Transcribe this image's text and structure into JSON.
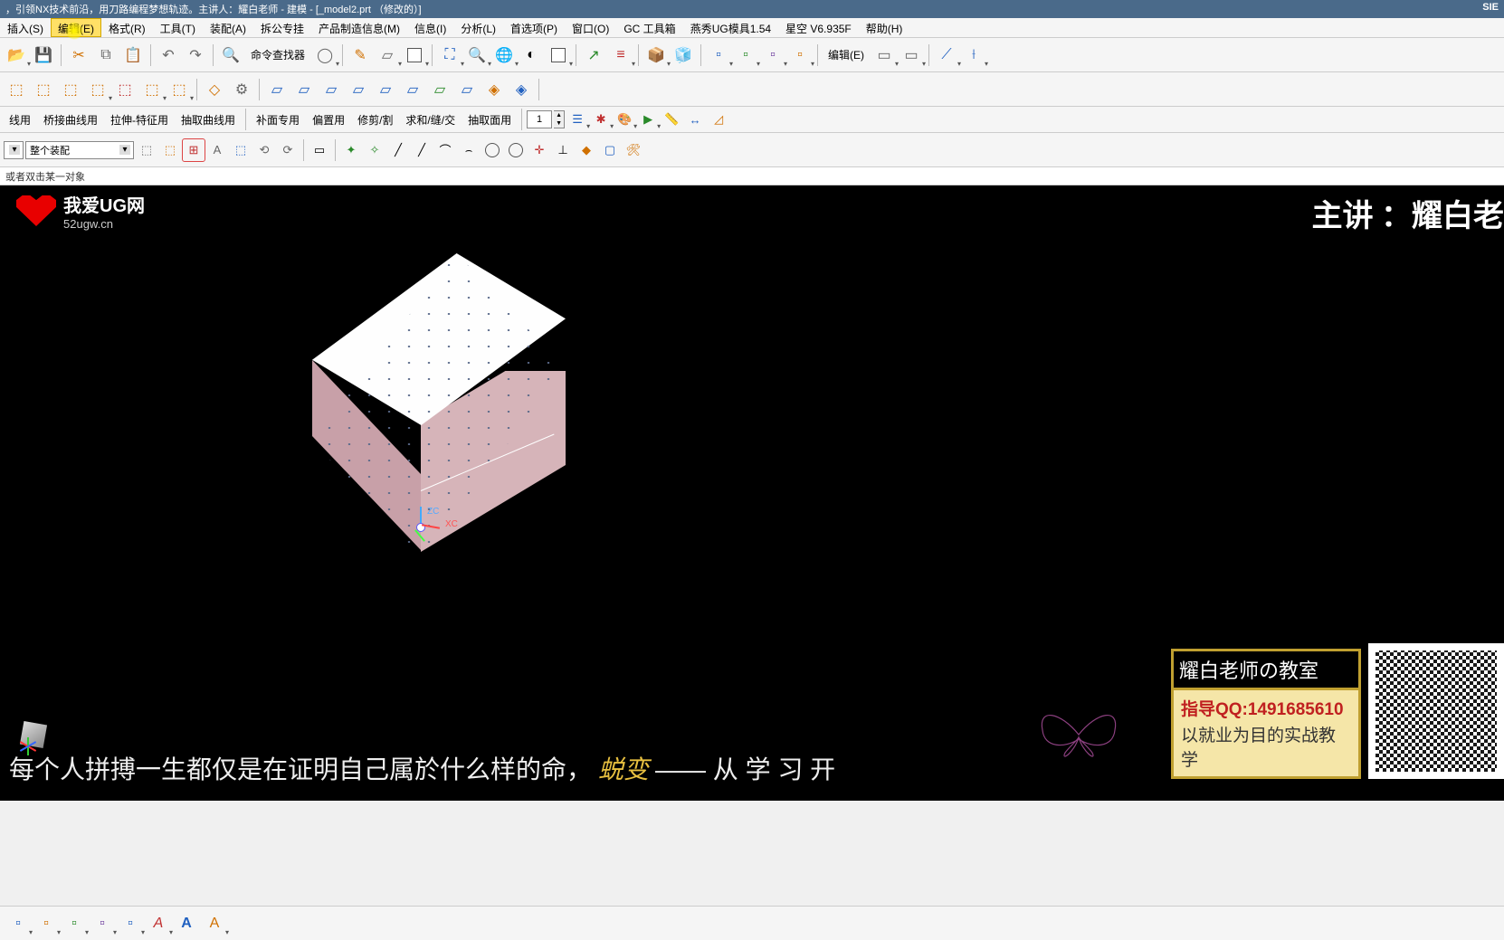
{
  "title_left": "，引领NX技术前沿，用刀路编程梦想轨迹。主讲人：耀白老师 - 建模 - [_model2.prt （修改的）]",
  "title_right": "SIE",
  "menus": [
    "插入(S)",
    "编辑(E)",
    "格式(R)",
    "工具(T)",
    "装配(A)",
    "拆公专挂",
    "产品制造信息(M)",
    "信息(I)",
    "分析(L)",
    "首选项(P)",
    "窗口(O)",
    "GC 工具箱",
    "燕秀UG模具1.54",
    "星空 V6.935F",
    "帮助(H)"
  ],
  "cmd_finder_label": "命令查找器",
  "edit_label": "编辑(E)",
  "row4": {
    "items": [
      "线用",
      "桥接曲线用",
      "拉伸-特征用",
      "抽取曲线用",
      "补面专用",
      "偏置用",
      "修剪/割",
      "求和/缝/交",
      "抽取面用"
    ],
    "num": "1"
  },
  "combo_value": "整个装配",
  "status_hint": "或者双击某一对象",
  "logo_t1": "我爱UG网",
  "logo_t2": "52ugw.cn",
  "presenter": "主讲 ：耀白老",
  "csys": {
    "zc": "ZC",
    "xc": "XC"
  },
  "subtitle_a": "每个人拼搏一生都仅是在证明自己属於什么样的命，",
  "subtitle_b": "蜕变",
  "subtitle_c": "—— 从 学 习 开",
  "infobox": {
    "head": "耀白老师の教室",
    "l1": "指导QQ:1491685610",
    "l2": "以就业为目的实战教学"
  }
}
